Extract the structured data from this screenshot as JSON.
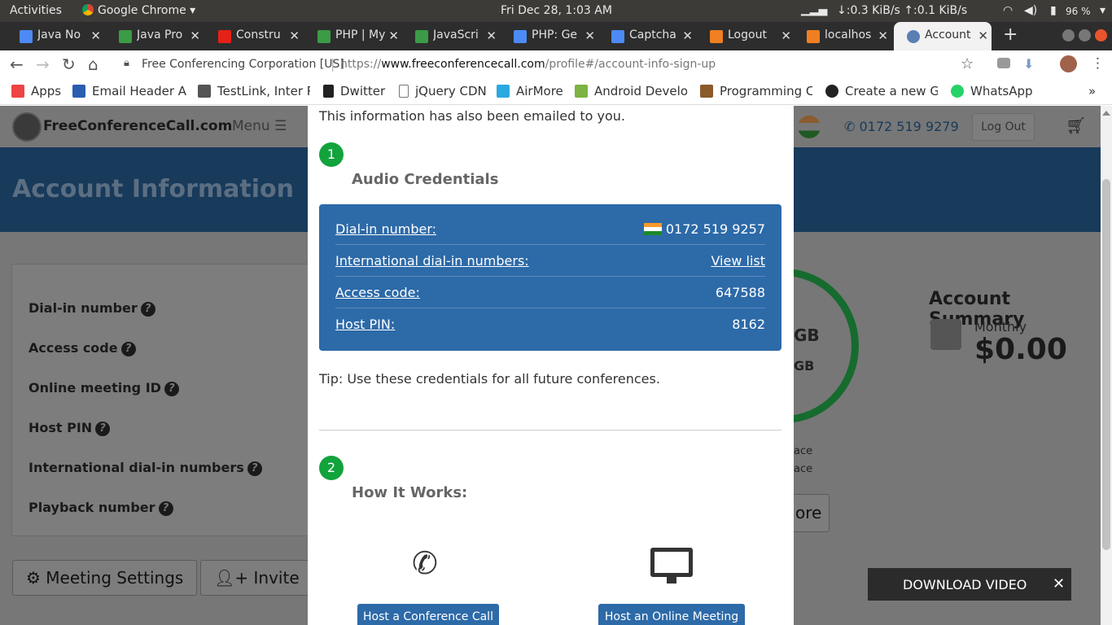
{
  "system": {
    "activities": "Activities",
    "app": "Google Chrome",
    "clock": "Fri Dec 28,  1:03 AM",
    "net": "↓:0.3 KiB/s ↑:0.1 KiB/s",
    "battery": "96 %"
  },
  "tabs": [
    {
      "title": "Java No",
      "color": "#4c8bf5"
    },
    {
      "title": "Java Pro",
      "color": "#3c9b46"
    },
    {
      "title": "Constru",
      "color": "#e62117"
    },
    {
      "title": "PHP | My",
      "color": "#3c9b46"
    },
    {
      "title": "JavaScri",
      "color": "#3c9b46"
    },
    {
      "title": "PHP: Ge",
      "color": "#4c8bf5"
    },
    {
      "title": "Captcha",
      "color": "#4c8bf5"
    },
    {
      "title": "Logout",
      "color": "#f07f22"
    },
    {
      "title": "localhos",
      "color": "#f07f22"
    },
    {
      "title": "Account",
      "color": "#5a7fb5"
    }
  ],
  "address": {
    "site": "Free Conferencing Corporation [US]",
    "url_prefix": "https://",
    "url_domain": "www.freeconferencecall.com",
    "url_path": "/profile#/account-info-sign-up"
  },
  "bookmarks": [
    {
      "label": "Apps",
      "color": "#e44"
    },
    {
      "label": "Email Header An",
      "color": "#2a5db0"
    },
    {
      "label": "TestLink, Inter P",
      "color": "#555"
    },
    {
      "label": "Dwitter",
      "color": "#222"
    },
    {
      "label": "jQuery CDN",
      "color": "#999"
    },
    {
      "label": "AirMore",
      "color": "#2aa9e0"
    },
    {
      "label": "Android Develop",
      "color": "#7cb342"
    },
    {
      "label": "Programming Co",
      "color": "#8a5a2b"
    },
    {
      "label": "Create a new Gis",
      "color": "#222"
    },
    {
      "label": "WhatsApp",
      "color": "#25d366"
    }
  ],
  "site": {
    "logo": "FreeConferenceCall.com",
    "menu": "Menu",
    "phone": "0172 519 9279",
    "logout": "Log Out",
    "hero_title": "Account Information",
    "fields": [
      "Dial-in number",
      "Access code",
      "Online meeting ID",
      "Host PIN",
      "International dial-in numbers",
      "Playback number"
    ],
    "summary_title": "Account Summary",
    "plan": "Monthly",
    "price": "$0.00",
    "partial_gb1": "GB",
    "partial_gb2": "GB",
    "partial_ace1": "ace",
    "partial_ace2": "ace",
    "partial_more": "ore",
    "meeting_settings": "Meeting Settings",
    "invite": "Invite"
  },
  "modal": {
    "emailed": "This information has also been emailed to you.",
    "step1": "1",
    "audio_title": "Audio Credentials",
    "dialin_label": "Dial-in number:",
    "dialin_value": "0172 519 9257",
    "intl_label": "International dial-in numbers:",
    "intl_value": "View list",
    "access_label": "Access code:",
    "access_value": "647588",
    "pin_label": "Host PIN:",
    "pin_value": "8162",
    "tip": "Tip: Use these credentials for all future conferences.",
    "step2": "2",
    "how_title": "How It Works:",
    "host_call": "Host a Conference Call",
    "host_meeting": "Host an Online Meeting"
  },
  "download": {
    "label": "DOWNLOAD VIDEO"
  }
}
